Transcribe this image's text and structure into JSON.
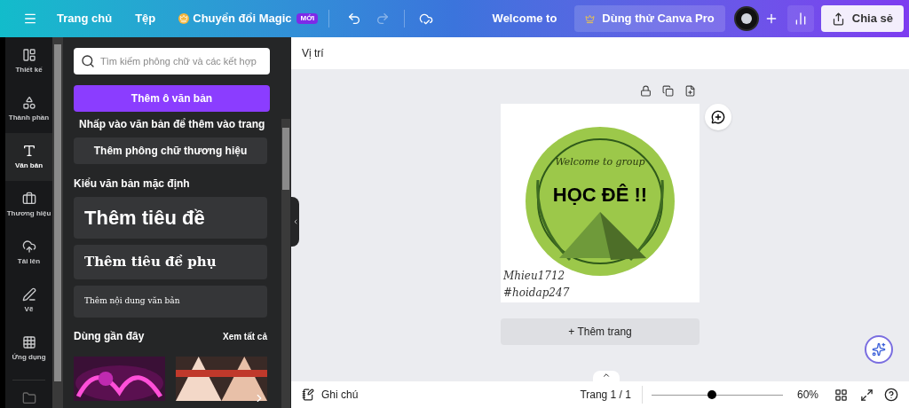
{
  "topbar": {
    "menu": [
      "Trang chủ",
      "Tệp"
    ],
    "magic": {
      "label": "Chuyển đổi Magic",
      "badge": "MỚI"
    },
    "title": "Welcome to",
    "pro": "Dùng thử Canva Pro",
    "share": "Chia sẻ"
  },
  "rail": [
    {
      "label": "Thiết kế",
      "selected": false
    },
    {
      "label": "Thành phần",
      "selected": false
    },
    {
      "label": "Văn bản",
      "selected": true
    },
    {
      "label": "Thương hiệu",
      "selected": false
    },
    {
      "label": "Tải lên",
      "selected": false
    },
    {
      "label": "Vẽ",
      "selected": false
    },
    {
      "label": "Ứng dụng",
      "selected": false
    }
  ],
  "panel": {
    "search": {
      "placeholder": "Tìm kiếm phông chữ và các kết hợp"
    },
    "add_button": "Thêm ô văn bản",
    "hint": "Nhấp vào văn bản để thêm vào trang",
    "brand_button": "Thêm phông chữ thương hiệu",
    "defaults_title": "Kiểu văn bản mặc định",
    "styles": [
      {
        "kind": "heading",
        "label": "Thêm tiêu đề"
      },
      {
        "kind": "subheading",
        "label": "Thêm tiêu đề phụ"
      },
      {
        "kind": "body",
        "label": "Thêm nội dung văn bản"
      }
    ],
    "recent_title": "Dùng gần đây",
    "see_all": "Xem tất cả"
  },
  "canvas": {
    "toolbar": "Vị trí",
    "design": {
      "greeting": "Welcome to group",
      "title": "HỌC ĐÊ !!",
      "credit": [
        "Mhieu1712",
        "#hoidap247"
      ]
    },
    "add_page": "+ Thêm trang"
  },
  "bottom": {
    "notes": "Ghi chú",
    "page": "Trang 1 / 1",
    "zoom": {
      "level": 0.46
    },
    "zoom_reading": "60%"
  }
}
